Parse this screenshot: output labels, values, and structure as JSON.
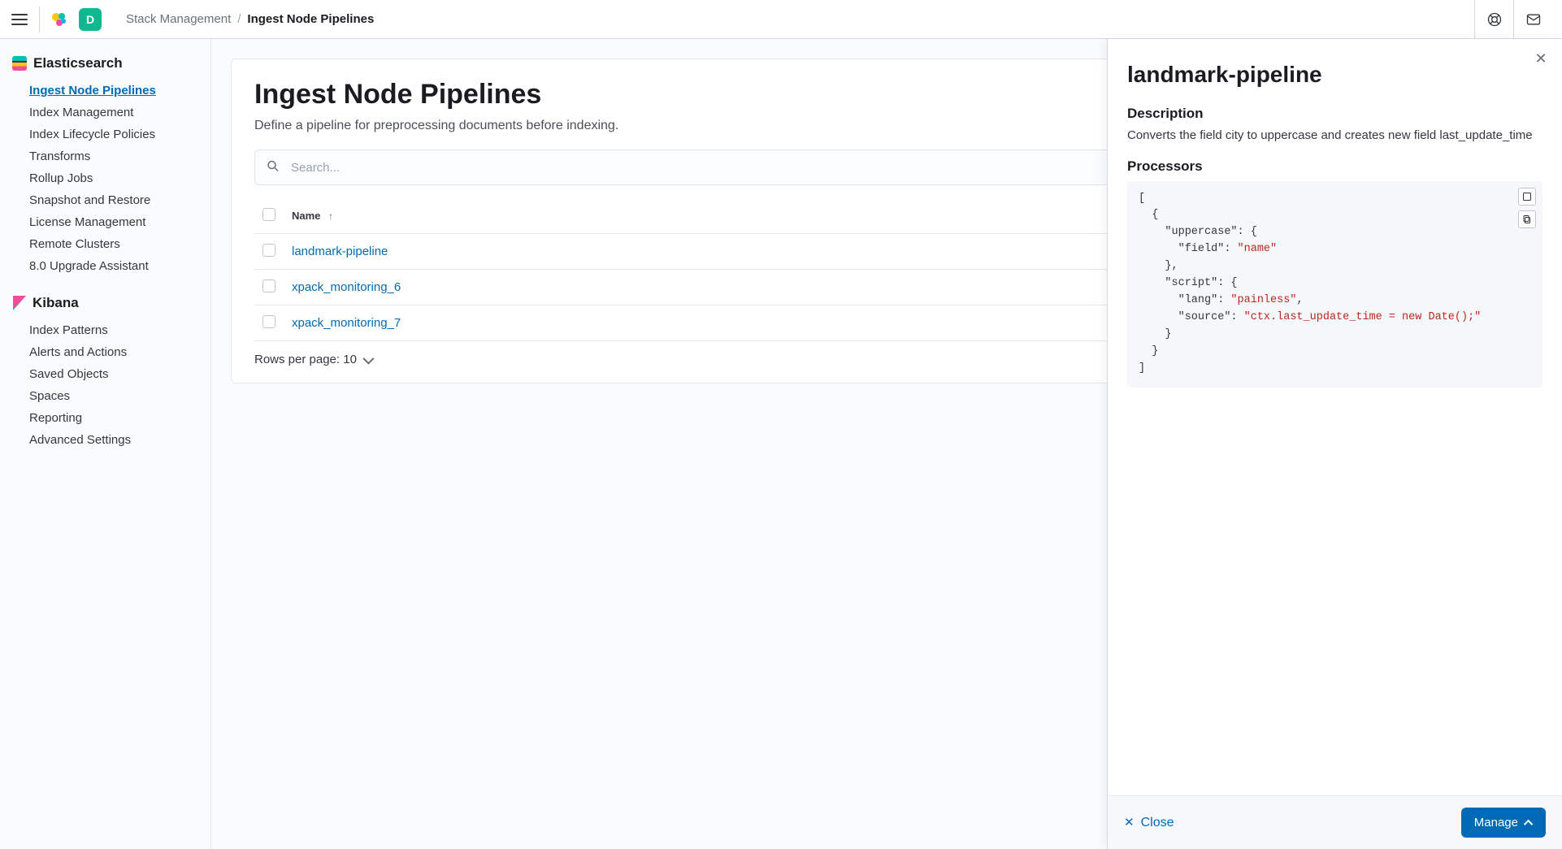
{
  "topbar": {
    "space_letter": "D",
    "breadcrumbs": {
      "parent": "Stack Management",
      "separator": "/",
      "current": "Ingest Node Pipelines"
    }
  },
  "sidebar": {
    "section1": {
      "title": "Elasticsearch",
      "items": [
        "Ingest Node Pipelines",
        "Index Management",
        "Index Lifecycle Policies",
        "Transforms",
        "Rollup Jobs",
        "Snapshot and Restore",
        "License Management",
        "Remote Clusters",
        "8.0 Upgrade Assistant"
      ],
      "active_index": 0
    },
    "section2": {
      "title": "Kibana",
      "items": [
        "Index Patterns",
        "Alerts and Actions",
        "Saved Objects",
        "Spaces",
        "Reporting",
        "Advanced Settings"
      ]
    }
  },
  "main": {
    "title": "Ingest Node Pipelines",
    "description": "Define a pipeline for preprocessing documents before indexing.",
    "search_placeholder": "Search...",
    "table": {
      "header_name": "Name",
      "rows": [
        "landmark-pipeline",
        "xpack_monitoring_6",
        "xpack_monitoring_7"
      ]
    },
    "rows_per_page": "Rows per page: 10"
  },
  "flyout": {
    "title": "landmark-pipeline",
    "desc_heading": "Description",
    "description": "Converts the field city to uppercase and creates new field last_update_time",
    "proc_heading": "Processors",
    "code": {
      "l1": "[",
      "l2": "  {",
      "k_uppercase": "    \"uppercase\"",
      "colon_brace": ": {",
      "k_field": "      \"field\"",
      "v_name": "\"name\"",
      "l_close1": "    },",
      "k_script": "    \"script\"",
      "k_lang": "      \"lang\"",
      "v_painless": "\"painless\"",
      "comma": ",",
      "k_source": "      \"source\"",
      "v_source": "\"ctx.last_update_time = new Date();\"",
      "l_close2": "    }",
      "l_close3": "  }",
      "l_close4": "]"
    },
    "close_label": "Close",
    "manage_label": "Manage"
  }
}
